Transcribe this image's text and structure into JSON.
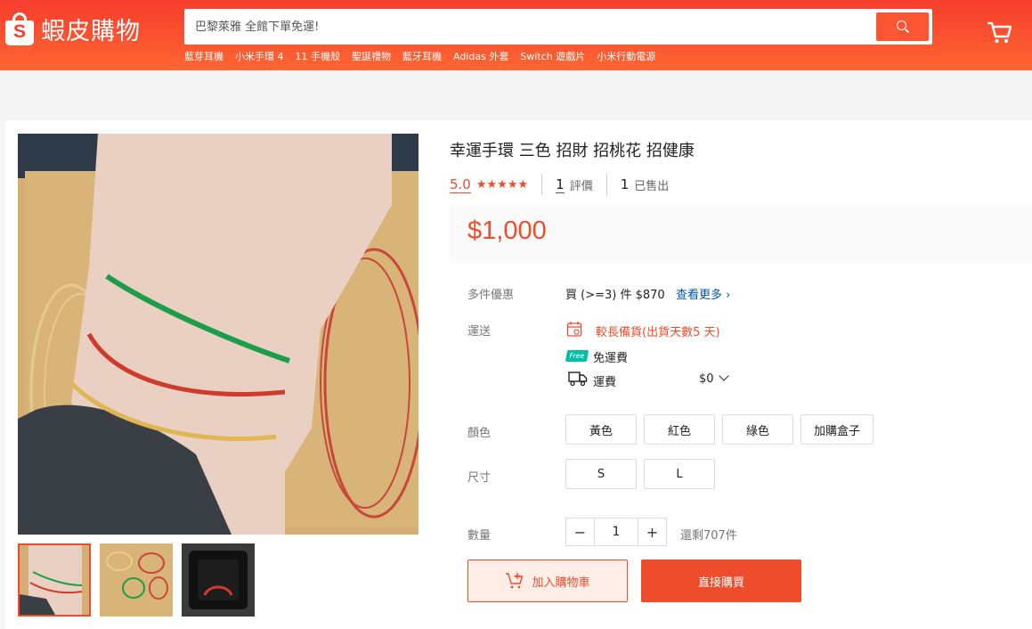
{
  "header": {
    "logo_text": "蝦皮購物",
    "logo_letter": "S",
    "search_placeholder": "巴黎萊雅 全館下單免運!",
    "hints": [
      "藍芽耳機",
      "小米手環 4",
      "11 手機殼",
      "聖誕禮物",
      "藍牙耳機",
      "Adidas 外套",
      "Switch 遊戲片",
      "小米行動電源"
    ]
  },
  "product": {
    "title": "幸運手環 三色 招財 招桃花 招健康",
    "rating": "5.0",
    "stars": "★★★★★",
    "reviews_count": "1",
    "reviews_label": "評價",
    "sold_count": "1",
    "sold_label": "已售出",
    "price": "$1,000"
  },
  "bulk": {
    "label": "多件優惠",
    "text": "買 (>=3) 件 $870",
    "more": "查看更多"
  },
  "shipping": {
    "label": "運送",
    "prep": "較長備貨(出貨天數5 天)",
    "free_badge": "Free",
    "free_text": "免運費",
    "fee_label": "運費",
    "fee_value": "$0"
  },
  "colors": {
    "label": "顏色",
    "options": [
      "黃色",
      "紅色",
      "綠色",
      "加購盒子"
    ]
  },
  "sizes": {
    "label": "尺寸",
    "options": [
      "S",
      "L"
    ]
  },
  "quantity": {
    "label": "數量",
    "minus": "−",
    "value": "1",
    "plus": "+",
    "stock": "還剩707件"
  },
  "actions": {
    "add_to_cart": "加入購物車",
    "buy_now": "直接購買"
  },
  "colors_theme": {
    "brand": "#ee4d2d",
    "link": "#0055aa",
    "free_badge": "#00bfa5"
  }
}
